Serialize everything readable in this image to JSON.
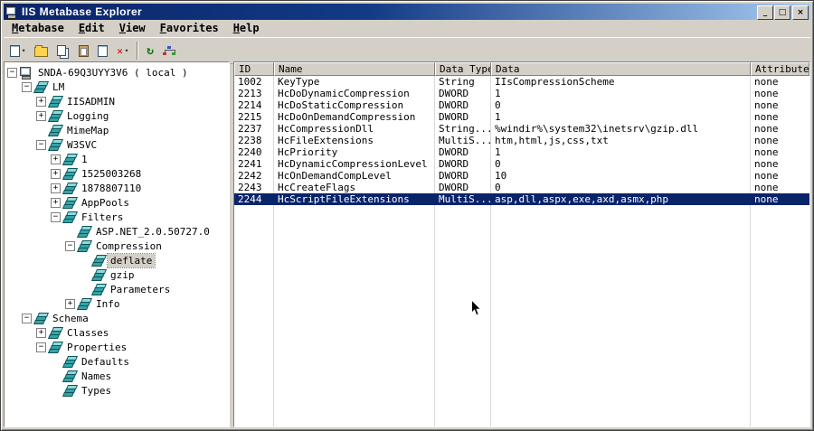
{
  "window": {
    "title": "IIS Metabase Explorer",
    "controls": [
      {
        "name": "minimize-button",
        "glyph": "_"
      },
      {
        "name": "maximize-button",
        "glyph": "□"
      },
      {
        "name": "close-button",
        "glyph": "×"
      }
    ]
  },
  "menu": {
    "items": [
      {
        "label": "Metabase"
      },
      {
        "label": "Edit"
      },
      {
        "label": "View"
      },
      {
        "label": "Favorites"
      },
      {
        "label": "Help"
      }
    ]
  },
  "toolbar": {
    "buttons": [
      {
        "name": "new-key-button"
      },
      {
        "name": "open-folder-button"
      },
      {
        "name": "copy-button"
      },
      {
        "name": "paste-button"
      },
      {
        "name": "edit-record-button"
      },
      {
        "name": "delete-button",
        "glyph": "✕"
      },
      {
        "name": "separator"
      },
      {
        "name": "refresh-button",
        "glyph": "↻"
      },
      {
        "name": "connect-computer-button"
      }
    ]
  },
  "tree": {
    "items": [
      {
        "label": "SNDA-69Q3UYY3V6 ( local )",
        "depth": 0,
        "expander": "minus",
        "icon": "computer",
        "selected": false
      },
      {
        "label": "LM",
        "depth": 1,
        "expander": "minus",
        "icon": "db",
        "selected": false
      },
      {
        "label": "IISADMIN",
        "depth": 2,
        "expander": "plus",
        "icon": "db",
        "selected": false
      },
      {
        "label": "Logging",
        "depth": 2,
        "expander": "plus",
        "icon": "db",
        "selected": false
      },
      {
        "label": "MimeMap",
        "depth": 2,
        "expander": "none",
        "icon": "db",
        "selected": false
      },
      {
        "label": "W3SVC",
        "depth": 2,
        "expander": "minus",
        "icon": "db",
        "selected": false
      },
      {
        "label": "1",
        "depth": 3,
        "expander": "plus",
        "icon": "db",
        "selected": false
      },
      {
        "label": "1525003268",
        "depth": 3,
        "expander": "plus",
        "icon": "db",
        "selected": false
      },
      {
        "label": "1878807110",
        "depth": 3,
        "expander": "plus",
        "icon": "db",
        "selected": false
      },
      {
        "label": "AppPools",
        "depth": 3,
        "expander": "plus",
        "icon": "db",
        "selected": false
      },
      {
        "label": "Filters",
        "depth": 3,
        "expander": "minus",
        "icon": "db",
        "selected": false
      },
      {
        "label": "ASP.NET_2.0.50727.0",
        "depth": 4,
        "expander": "none",
        "icon": "db",
        "selected": false
      },
      {
        "label": "Compression",
        "depth": 4,
        "expander": "minus",
        "icon": "db",
        "selected": false
      },
      {
        "label": "deflate",
        "depth": 5,
        "expander": "none",
        "icon": "db",
        "selected": true
      },
      {
        "label": "gzip",
        "depth": 5,
        "expander": "none",
        "icon": "db",
        "selected": false
      },
      {
        "label": "Parameters",
        "depth": 5,
        "expander": "none",
        "icon": "db",
        "selected": false
      },
      {
        "label": "Info",
        "depth": 4,
        "expander": "plus",
        "icon": "db",
        "selected": false
      },
      {
        "label": "Schema",
        "depth": 1,
        "expander": "minus",
        "icon": "db",
        "selected": false
      },
      {
        "label": "Classes",
        "depth": 2,
        "expander": "plus",
        "icon": "db",
        "selected": false
      },
      {
        "label": "Properties",
        "depth": 2,
        "expander": "minus",
        "icon": "db",
        "selected": false
      },
      {
        "label": "Defaults",
        "depth": 3,
        "expander": "none",
        "icon": "db",
        "selected": false
      },
      {
        "label": "Names",
        "depth": 3,
        "expander": "none",
        "icon": "db",
        "selected": false
      },
      {
        "label": "Types",
        "depth": 3,
        "expander": "none",
        "icon": "db",
        "selected": false
      }
    ]
  },
  "grid": {
    "columns": [
      "ID",
      "Name",
      "Data Type",
      "Data",
      "Attributes"
    ],
    "rows": [
      [
        "1002",
        "KeyType",
        "String",
        "IIsCompressionScheme",
        "none"
      ],
      [
        "2213",
        "HcDoDynamicCompression",
        "DWORD",
        "1",
        "none"
      ],
      [
        "2214",
        "HcDoStaticCompression",
        "DWORD",
        "0",
        "none"
      ],
      [
        "2215",
        "HcDoOnDemandCompression",
        "DWORD",
        "1",
        "none"
      ],
      [
        "2237",
        "HcCompressionDll",
        "String...",
        "%windir%\\system32\\inetsrv\\gzip.dll",
        "none"
      ],
      [
        "2238",
        "HcFileExtensions",
        "MultiS...",
        "htm,html,js,css,txt",
        "none"
      ],
      [
        "2240",
        "HcPriority",
        "DWORD",
        "1",
        "none"
      ],
      [
        "2241",
        "HcDynamicCompressionLevel",
        "DWORD",
        "0",
        "none"
      ],
      [
        "2242",
        "HcOnDemandCompLevel",
        "DWORD",
        "10",
        "none"
      ],
      [
        "2243",
        "HcCreateFlags",
        "DWORD",
        "0",
        "none"
      ],
      [
        "2244",
        "HcScriptFileExtensions",
        "MultiS...",
        "asp,dll,aspx,exe,axd,asmx,php",
        "none"
      ]
    ],
    "selected_row": 10
  }
}
